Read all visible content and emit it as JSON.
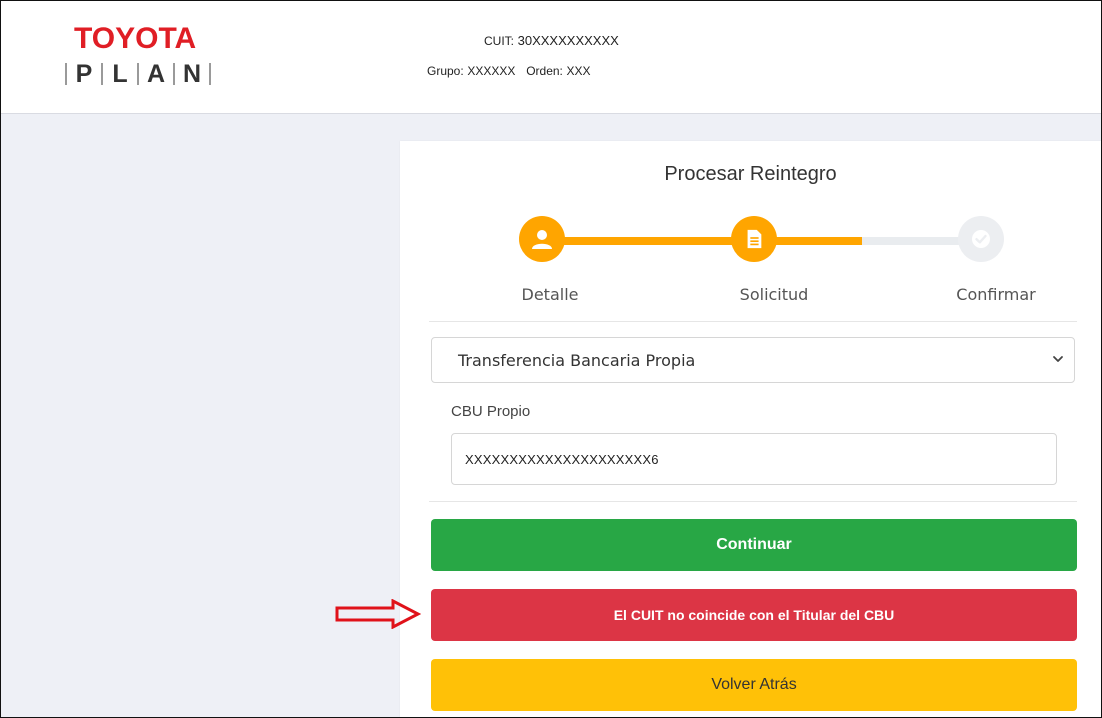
{
  "logo": {
    "top": "TOYOTA",
    "letters": [
      "P",
      "L",
      "A",
      "N"
    ]
  },
  "account": {
    "cuit_label": "CUIT:",
    "cuit_value": "30XXXXXXXXXX",
    "grupo_label": "Grupo:",
    "grupo_value": "XXXXXX",
    "orden_label": "Orden:",
    "orden_value": "XXX"
  },
  "card": {
    "title": "Procesar Reintegro",
    "steps": [
      {
        "label": "Detalle",
        "icon": "user-icon",
        "state": "done"
      },
      {
        "label": "Solicitud",
        "icon": "document-icon",
        "state": "active"
      },
      {
        "label": "Confirmar",
        "icon": "check-icon",
        "state": "pending"
      }
    ],
    "method_select": {
      "value": "Transferencia Bancaria Propia"
    },
    "cbu": {
      "label": "CBU Propio",
      "value": "XXXXXXXXXXXXXXXXXXXXX6"
    },
    "buttons": {
      "continue": "Continuar",
      "error": "El CUIT no coincide con el Titular del CBU",
      "back": "Volver Atrás"
    }
  },
  "colors": {
    "brand_red": "#e01e25",
    "step_active": "#ffa500",
    "step_pending": "#e9ecef",
    "success": "#28a745",
    "danger": "#dc3545",
    "warning": "#ffc107",
    "annotation_arrow": "#e0121a"
  }
}
